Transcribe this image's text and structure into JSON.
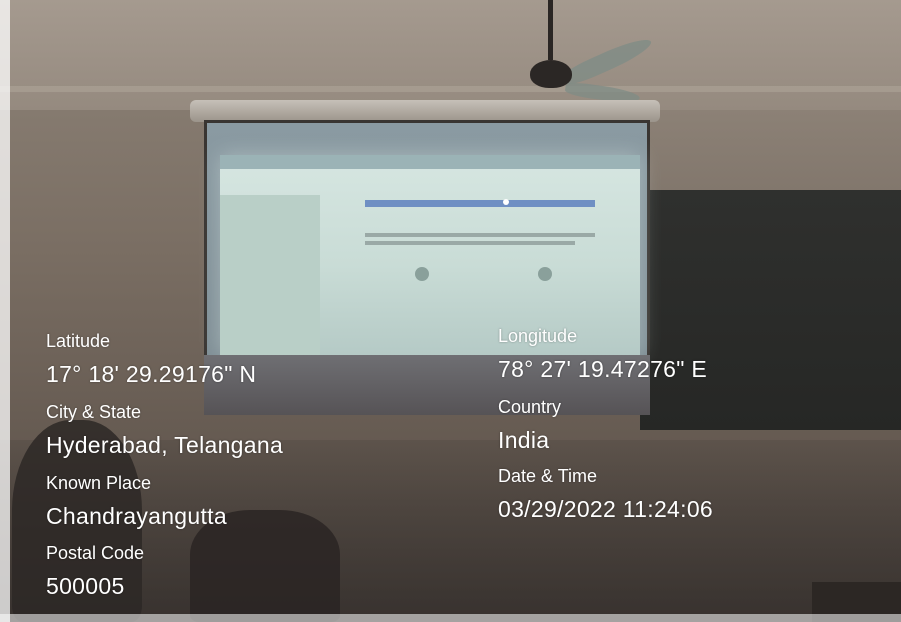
{
  "geo_overlay": {
    "latitude": {
      "label": "Latitude",
      "value": "17° 18' 29.29176\" N"
    },
    "longitude": {
      "label": "Longitude",
      "value": "78° 27' 19.47276\" E"
    },
    "city_state": {
      "label": "City & State",
      "value": "Hyderabad, Telangana"
    },
    "country": {
      "label": "Country",
      "value": "India"
    },
    "known_place": {
      "label": "Known Place",
      "value": "Chandrayangutta"
    },
    "date_time": {
      "label": "Date & Time",
      "value": "03/29/2022 11:24:06"
    },
    "postal_code": {
      "label": "Postal Code",
      "value": "500005"
    }
  },
  "colors": {
    "overlay_text": "#ffffff",
    "blackboard": "#2f302e",
    "projection": "#d6e6e1"
  }
}
